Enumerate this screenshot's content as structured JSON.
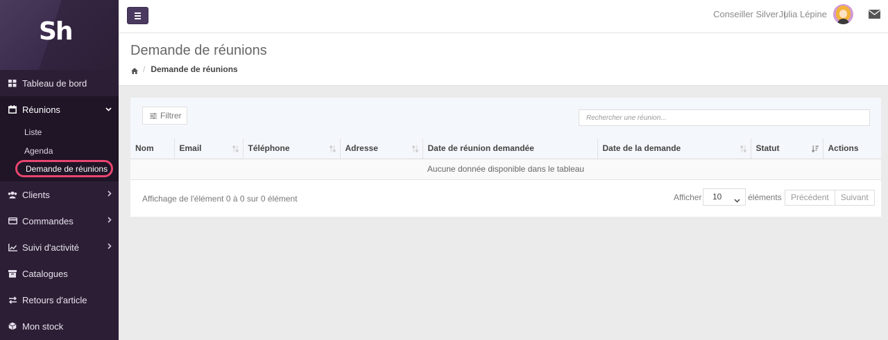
{
  "app": {
    "logo_text": "Sh"
  },
  "sidebar": {
    "items": [
      {
        "label": "Tableau de bord",
        "icon": "grid-icon"
      },
      {
        "label": "Réunions",
        "icon": "calendar-icon"
      },
      {
        "label": "Clients",
        "icon": "users-icon"
      },
      {
        "label": "Commandes",
        "icon": "card-icon"
      },
      {
        "label": "Suivi d'activité",
        "icon": "chart-line-icon"
      },
      {
        "label": "Catalogues",
        "icon": "archive-icon"
      },
      {
        "label": "Retours d'article",
        "icon": "exchange-icon"
      },
      {
        "label": "Mon stock",
        "icon": "cube-icon"
      }
    ],
    "sub_items": [
      {
        "label": "Liste"
      },
      {
        "label": "Agenda"
      },
      {
        "label": "Demande de réunions"
      }
    ]
  },
  "topbar": {
    "role": "Conseiller Silver",
    "separator": "|",
    "user_name": "Julia Lépine"
  },
  "page": {
    "title": "Demande de réunions",
    "breadcrumb_current": "Demande de réunions",
    "breadcrumb_separator": "/"
  },
  "toolbar": {
    "filter_label": "Filtrer",
    "search_placeholder": "Rechercher une réunion..."
  },
  "table": {
    "columns": [
      "Nom",
      "Email",
      "Téléphone",
      "Adresse",
      "Date de réunion demandée",
      "Date de la demande",
      "Statut",
      "Actions"
    ],
    "empty_message": "Aucune donnée disponible dans le tableau"
  },
  "footer": {
    "info": "Affichage de l'élément 0 à 0 sur 0 élément",
    "length_label": "Afficher",
    "length_value": "10",
    "length_suffix": "éléments",
    "prev_label": "Précédent",
    "next_label": "Suivant"
  },
  "colors": {
    "sidebar_bg": "#2c1f35",
    "accent": "#4b3a60",
    "highlight_ring": "#e8466f"
  }
}
